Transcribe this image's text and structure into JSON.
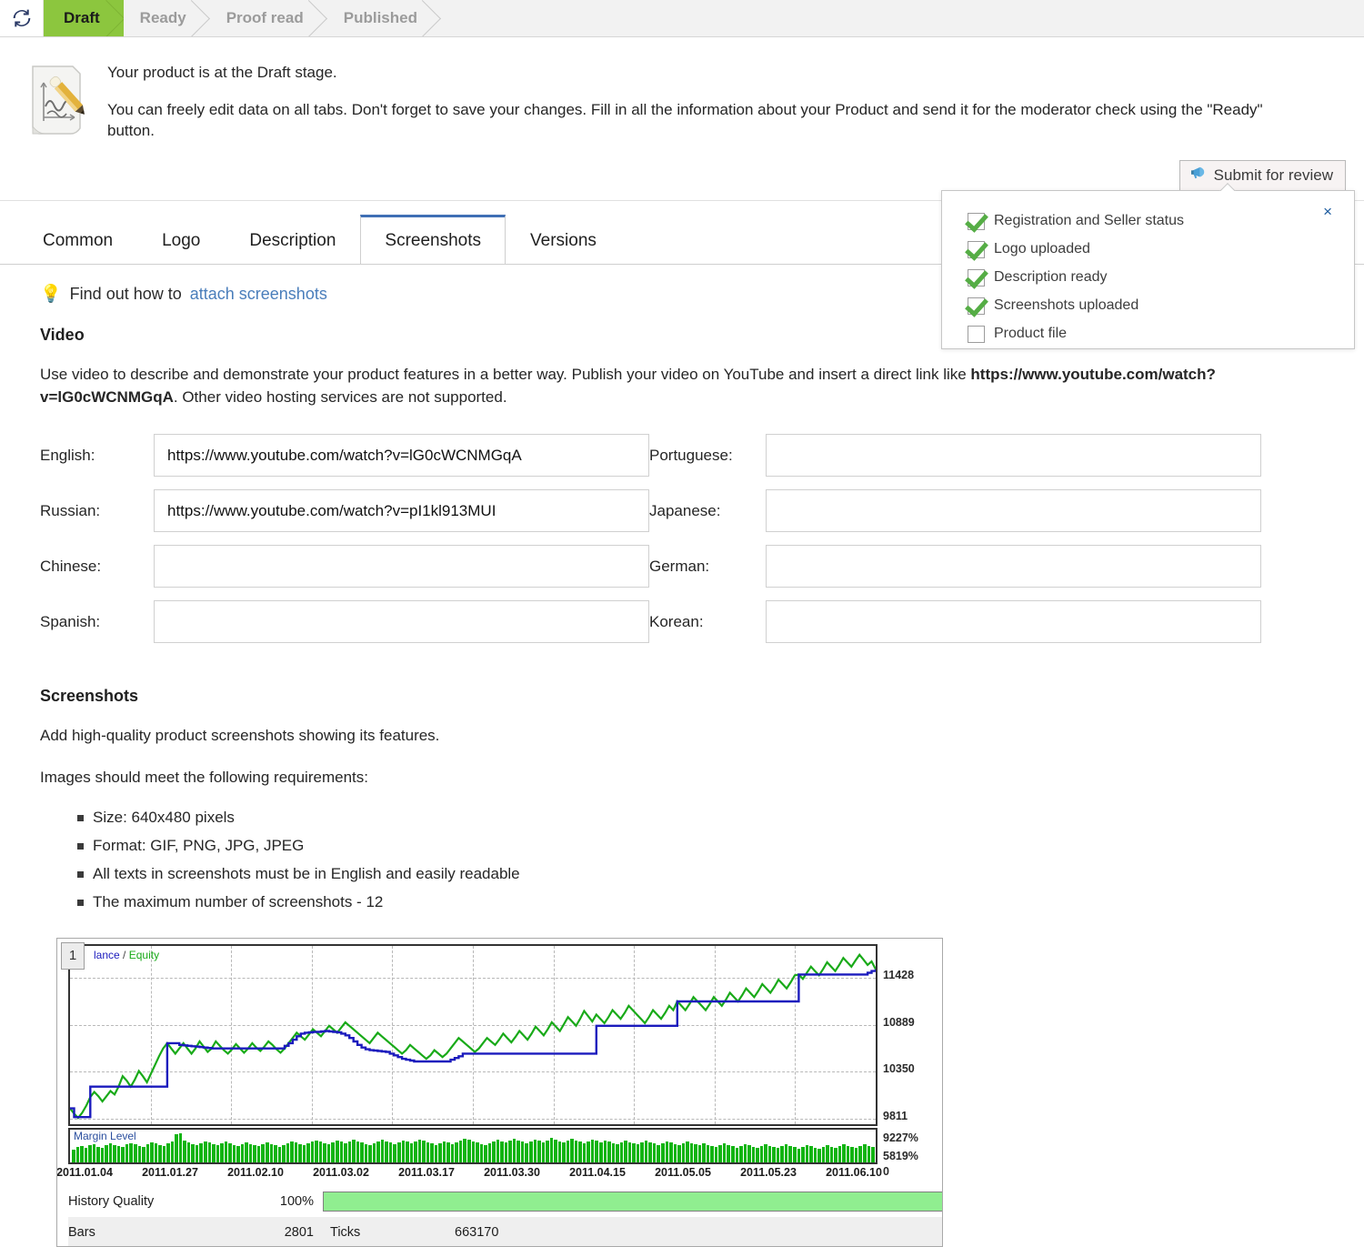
{
  "stagebar": {
    "refresh_icon": "refresh-icon",
    "stages": [
      {
        "label": "Draft",
        "active": true
      },
      {
        "label": "Ready",
        "active": false
      },
      {
        "label": "Proof read",
        "active": false
      },
      {
        "label": "Published",
        "active": false
      }
    ]
  },
  "notice": {
    "icon": "document-pencil-icon",
    "line1": "Your product is at the Draft stage.",
    "line2": "You can freely edit data on all tabs. Don't forget to save your changes. Fill in all the information about your Product and send it for the moderator check using the \"Ready\" button.",
    "submit_label": "Submit for review",
    "submit_icon": "megaphone-icon"
  },
  "popup": {
    "close_label": "×",
    "items": [
      {
        "label": "Registration and Seller status",
        "checked": true
      },
      {
        "label": "Logo uploaded",
        "checked": true
      },
      {
        "label": "Description ready",
        "checked": true
      },
      {
        "label": "Screenshots uploaded",
        "checked": true
      },
      {
        "label": "Product file",
        "checked": false
      }
    ]
  },
  "tabs": [
    {
      "label": "Common",
      "active": false
    },
    {
      "label": "Logo",
      "active": false
    },
    {
      "label": "Description",
      "active": false
    },
    {
      "label": "Screenshots",
      "active": true
    },
    {
      "label": "Versions",
      "active": false
    }
  ],
  "hint": {
    "icon": "lightbulb-icon",
    "prefix": "Find out how to ",
    "link": "attach screenshots"
  },
  "video": {
    "heading": "Video",
    "description_part1": "Use video to describe and demonstrate your product features in a better way. Publish your video on YouTube and insert a direct link like ",
    "description_url": "https://www.youtube.com/watch?v=lG0cWCNMGqA",
    "description_part2": ". Other video hosting services are not supported.",
    "fields_left": [
      {
        "label": "English:",
        "value": "https://www.youtube.com/watch?v=lG0cWCNMGqA",
        "placeholder": ""
      },
      {
        "label": "Russian:",
        "value": "https://www.youtube.com/watch?v=pI1kl913MUI",
        "placeholder": ""
      },
      {
        "label": "Chinese:",
        "value": "",
        "placeholder": ""
      },
      {
        "label": "Spanish:",
        "value": "",
        "placeholder": ""
      }
    ],
    "fields_right": [
      {
        "label": "Portuguese:",
        "value": "",
        "placeholder": ""
      },
      {
        "label": "Japanese:",
        "value": "",
        "placeholder": ""
      },
      {
        "label": "German:",
        "value": "",
        "placeholder": ""
      },
      {
        "label": "Korean:",
        "value": "",
        "placeholder": ""
      }
    ]
  },
  "screenshots": {
    "heading": "Screenshots",
    "intro": "Add high-quality product screenshots showing its features.",
    "requirements_intro": "Images should meet the following requirements:",
    "requirements": [
      "Size: 640x480 pixels",
      "Format: GIF, PNG, JPG, JPEG",
      "All texts in screenshots must be in English and easily readable",
      "The maximum number of screenshots - 12"
    ],
    "thumbnail": {
      "badge": "1",
      "legend_balance": "lance",
      "legend_separator": "/",
      "legend_equity": "Equity",
      "margin_title": "Margin Level",
      "history_quality_label": "History Quality",
      "history_quality_value": "100%",
      "bars_label": "Bars",
      "bars_value": "2801",
      "ticks_label": "Ticks",
      "ticks_value": "663170"
    }
  },
  "chart_data": {
    "type": "line",
    "title": "Balance / Equity",
    "xlabel": "",
    "ylabel": "",
    "ylim": [
      9811,
      11697
    ],
    "grid": true,
    "legend_position": "top-left",
    "y_ticks": [
      "11428",
      "10889",
      "10350",
      "9811"
    ],
    "y_tick_values": [
      11428,
      10889,
      10350,
      9811
    ],
    "margin_y_ticks": [
      "9227%",
      "5819%",
      "0"
    ],
    "x_ticks": [
      "2011.01.04",
      "2011.01.27",
      "2011.02.10",
      "2011.03.02",
      "2011.03.17",
      "2011.03.30",
      "2011.04.15",
      "2011.05.05",
      "2011.05.23",
      "2011.06.10"
    ],
    "series": [
      {
        "name": "Balance",
        "color": "#1b1bbd",
        "values": [
          9930,
          9830,
          9830,
          9830,
          9830,
          10180,
          10180,
          10180,
          10180,
          10180,
          10180,
          10180,
          10180,
          10180,
          10180,
          10180,
          10180,
          10180,
          10180,
          10180,
          10180,
          10180,
          10180,
          10180,
          10680,
          10680,
          10680,
          10660,
          10655,
          10650,
          10645,
          10640,
          10635,
          10630,
          10625,
          10620,
          10620,
          10620,
          10620,
          10620,
          10620,
          10620,
          10620,
          10620,
          10620,
          10620,
          10620,
          10620,
          10620,
          10620,
          10620,
          10620,
          10620,
          10650,
          10680,
          10720,
          10760,
          10790,
          10800,
          10805,
          10810,
          10810,
          10815,
          10820,
          10815,
          10810,
          10805,
          10790,
          10770,
          10740,
          10700,
          10660,
          10630,
          10610,
          10600,
          10595,
          10590,
          10585,
          10580,
          10560,
          10540,
          10520,
          10500,
          10490,
          10480,
          10470,
          10470,
          10470,
          10470,
          10470,
          10470,
          10470,
          10470,
          10470,
          10490,
          10510,
          10530,
          10560,
          10560,
          10560,
          10560,
          10560,
          10560,
          10560,
          10560,
          10560,
          10560,
          10560,
          10560,
          10560,
          10560,
          10560,
          10560,
          10560,
          10560,
          10560,
          10560,
          10560,
          10560,
          10560,
          10560,
          10560,
          10560,
          10560,
          10560,
          10560,
          10560,
          10560,
          10560,
          10560,
          10880,
          10880,
          10880,
          10880,
          10880,
          10880,
          10880,
          10880,
          10880,
          10880,
          10880,
          10880,
          10880,
          10880,
          10880,
          10880,
          10880,
          10880,
          10880,
          10880,
          11160,
          11160,
          11160,
          11160,
          11160,
          11160,
          11160,
          11160,
          11160,
          11160,
          11160,
          11160,
          11160,
          11160,
          11160,
          11160,
          11160,
          11160,
          11160,
          11160,
          11160,
          11160,
          11160,
          11160,
          11160,
          11160,
          11160,
          11160,
          11160,
          11160,
          11470,
          11470,
          11470,
          11470,
          11470,
          11470,
          11470,
          11470,
          11470,
          11470,
          11470,
          11470,
          11470,
          11470,
          11470,
          11470,
          11470,
          11490,
          11510,
          11530
        ]
      },
      {
        "name": "Equity",
        "color": "#19aa19",
        "values": [
          9930,
          9870,
          9820,
          9880,
          9960,
          10060,
          10120,
          10070,
          10010,
          10070,
          10130,
          10090,
          10180,
          10300,
          10250,
          10180,
          10260,
          10360,
          10300,
          10230,
          10330,
          10430,
          10530,
          10620,
          10680,
          10620,
          10560,
          10620,
          10680,
          10620,
          10560,
          10620,
          10700,
          10640,
          10580,
          10620,
          10700,
          10650,
          10600,
          10560,
          10610,
          10670,
          10620,
          10570,
          10620,
          10680,
          10630,
          10590,
          10640,
          10700,
          10660,
          10610,
          10570,
          10620,
          10680,
          10740,
          10800,
          10760,
          10720,
          10780,
          10840,
          10800,
          10760,
          10820,
          10880,
          10840,
          10800,
          10860,
          10920,
          10880,
          10840,
          10800,
          10760,
          10720,
          10680,
          10740,
          10800,
          10760,
          10720,
          10680,
          10640,
          10600,
          10560,
          10600,
          10660,
          10620,
          10580,
          10540,
          10500,
          10540,
          10600,
          10560,
          10520,
          10560,
          10620,
          10680,
          10740,
          10700,
          10660,
          10620,
          10580,
          10620,
          10680,
          10740,
          10700,
          10660,
          10720,
          10790,
          10740,
          10690,
          10750,
          10820,
          10770,
          10720,
          10790,
          10870,
          10820,
          10770,
          10840,
          10920,
          10870,
          10820,
          10900,
          10980,
          10930,
          10880,
          10960,
          11050,
          10990,
          10930,
          11010,
          10960,
          10910,
          10980,
          11060,
          11010,
          10960,
          11030,
          11110,
          11060,
          11010,
          10960,
          10910,
          10980,
          11060,
          11010,
          10960,
          11030,
          11110,
          11060,
          11160,
          11110,
          11060,
          11130,
          11210,
          11160,
          11110,
          11060,
          11130,
          11210,
          11160,
          11110,
          11180,
          11260,
          11210,
          11160,
          11230,
          11310,
          11260,
          11210,
          11280,
          11360,
          11310,
          11260,
          11330,
          11410,
          11360,
          11310,
          11380,
          11460,
          11470,
          11420,
          11490,
          11560,
          11510,
          11460,
          11530,
          11610,
          11560,
          11510,
          11580,
          11660,
          11610,
          11560,
          11630,
          11697,
          11640,
          11580,
          11620,
          11530
        ]
      }
    ],
    "margin_level": {
      "name": "Margin Level",
      "color": "#11b411",
      "values": [
        42,
        48,
        52,
        46,
        55,
        58,
        50,
        47,
        54,
        60,
        56,
        51,
        49,
        57,
        62,
        59,
        53,
        50,
        58,
        64,
        61,
        55,
        52,
        60,
        66,
        90,
        94,
        70,
        64,
        58,
        55,
        62,
        68,
        63,
        57,
        54,
        60,
        66,
        61,
        56,
        52,
        58,
        64,
        59,
        55,
        51,
        57,
        63,
        58,
        54,
        50,
        56,
        62,
        67,
        63,
        58,
        54,
        60,
        66,
        71,
        67,
        62,
        58,
        64,
        70,
        66,
        61,
        67,
        73,
        68,
        64,
        59,
        55,
        61,
        67,
        72,
        68,
        63,
        59,
        65,
        71,
        66,
        62,
        68,
        74,
        69,
        65,
        60,
        56,
        62,
        68,
        63,
        59,
        65,
        71,
        76,
        72,
        67,
        63,
        59,
        55,
        61,
        67,
        73,
        68,
        64,
        70,
        76,
        71,
        66,
        62,
        68,
        74,
        69,
        65,
        71,
        77,
        72,
        67,
        63,
        69,
        75,
        70,
        66,
        62,
        68,
        74,
        69,
        65,
        71,
        66,
        62,
        58,
        64,
        70,
        65,
        61,
        57,
        63,
        69,
        64,
        60,
        56,
        62,
        68,
        63,
        59,
        55,
        61,
        67,
        62,
        58,
        54,
        60,
        56,
        52,
        48,
        54,
        60,
        55,
        51,
        47,
        53,
        59,
        54,
        50,
        46,
        52,
        58,
        53,
        49,
        45,
        51,
        57,
        52,
        48,
        44,
        50,
        56,
        51,
        47,
        43,
        49,
        55,
        50,
        46,
        52,
        58,
        53,
        49,
        45,
        51,
        57,
        52,
        48
      ]
    }
  }
}
